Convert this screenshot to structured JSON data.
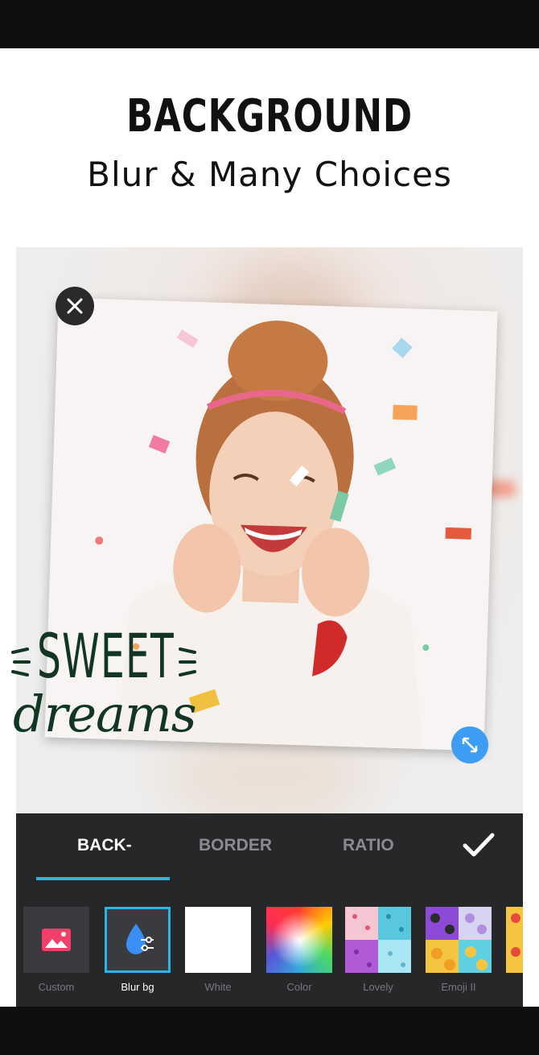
{
  "header": {
    "title": "BACKGROUND",
    "subtitle": "Blur & Many Choices"
  },
  "sticker": {
    "line1": "SWEET",
    "line2": "dreams"
  },
  "photo": {
    "description_icon": "photo-icon"
  },
  "tabs": [
    {
      "label": "BACK-",
      "active": true
    },
    {
      "label": "BORDER",
      "active": false
    },
    {
      "label": "RATIO",
      "active": false
    }
  ],
  "options": [
    {
      "label": "Custom",
      "icon": "image-icon"
    },
    {
      "label": "Blur bg",
      "icon": "droplet-adjust-icon",
      "selected": true
    },
    {
      "label": "White"
    },
    {
      "label": "Color"
    },
    {
      "label": "Lovely"
    },
    {
      "label": "Emoji II"
    }
  ],
  "colors": {
    "accent": "#2bb5e6",
    "panel": "#262729",
    "resize_button": "#3d9df4",
    "custom_icon": "#f2406a"
  }
}
